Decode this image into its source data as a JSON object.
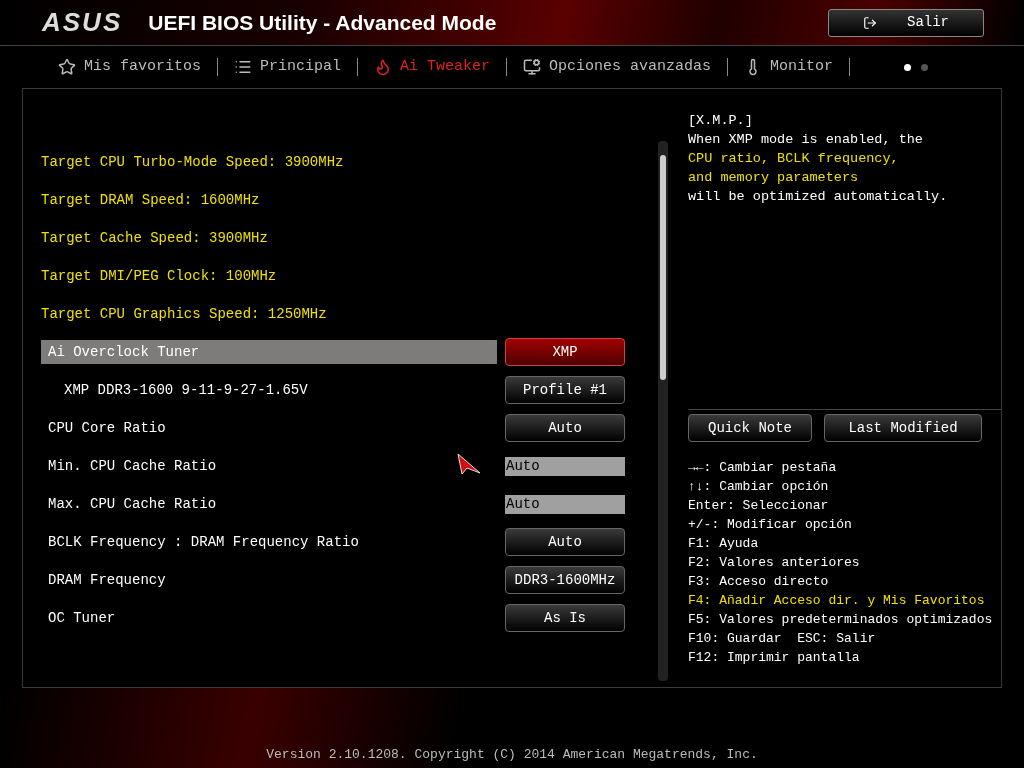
{
  "header": {
    "logo": "ASUS",
    "title": "UEFI BIOS Utility - Advanced Mode",
    "exit_button": "Salir"
  },
  "tabs": [
    {
      "label": "Mis favoritos",
      "selected": false
    },
    {
      "label": "Principal",
      "selected": false
    },
    {
      "label": "Ai Tweaker",
      "selected": true
    },
    {
      "label": "Opciones avanzadas",
      "selected": false
    },
    {
      "label": "Monitor",
      "selected": false
    }
  ],
  "pages": [
    {
      "selected": true
    },
    {
      "selected": false
    }
  ],
  "targets": [
    "Target CPU Turbo-Mode Speed: 3900MHz",
    "Target DRAM Speed: 1600MHz",
    "Target Cache Speed: 3900MHz",
    "Target DMI/PEG Clock: 100MHz",
    "Target CPU Graphics Speed: 1250MHz"
  ],
  "settings": [
    {
      "label": "Ai Overclock Tuner",
      "value": "XMP",
      "kind": "button",
      "selected": true,
      "indented": false
    },
    {
      "label": "XMP DDR3-1600 9-11-9-27-1.65V",
      "value": "Profile #1",
      "kind": "button",
      "selected": false,
      "indented": true
    },
    {
      "label": "CPU Core Ratio",
      "value": "Auto",
      "kind": "button",
      "selected": false,
      "indented": false
    },
    {
      "label": "Min. CPU Cache Ratio",
      "value": "Auto",
      "kind": "field",
      "selected": false,
      "indented": false
    },
    {
      "label": "Max. CPU Cache Ratio",
      "value": "Auto",
      "kind": "field",
      "selected": false,
      "indented": false
    },
    {
      "label": "BCLK Frequency : DRAM Frequency Ratio",
      "value": "Auto",
      "kind": "button",
      "selected": false,
      "indented": false
    },
    {
      "label": "DRAM Frequency",
      "value": "DDR3-1600MHz",
      "kind": "button",
      "selected": false,
      "indented": false
    },
    {
      "label": "OC Tuner",
      "value": "As Is",
      "kind": "button",
      "selected": false,
      "indented": false
    }
  ],
  "help": [
    {
      "text": "[X.M.P.]",
      "highlight": false
    },
    {
      "text": "When XMP mode is enabled, the",
      "highlight": false
    },
    {
      "text": "CPU ratio, BCLK frequency,",
      "highlight": true
    },
    {
      "text": "and memory parameters",
      "highlight": true
    },
    {
      "text": "will be optimized automatically.",
      "highlight": false
    }
  ],
  "side_buttons": [
    "Quick Note",
    "Last Modified"
  ],
  "keys": [
    {
      "text": "→←: Cambiar pestaña",
      "highlight": false
    },
    {
      "text": "↑↓: Cambiar opción",
      "highlight": false
    },
    {
      "text": "Enter: Seleccionar",
      "highlight": false
    },
    {
      "text": "+/-: Modificar opción",
      "highlight": false
    },
    {
      "text": "F1: Ayuda",
      "highlight": false
    },
    {
      "text": "F2: Valores anteriores",
      "highlight": false
    },
    {
      "text": "F3: Acceso directo",
      "highlight": false
    },
    {
      "text": "F4: Añadir Acceso dir. y Mis Favoritos",
      "highlight": true
    },
    {
      "text": "F5: Valores predeterminados optimizados",
      "highlight": false
    },
    {
      "text": "F10: Guardar  ESC: Salir",
      "highlight": false
    },
    {
      "text": "F12: Imprimir pantalla",
      "highlight": false
    }
  ],
  "footer": "Version 2.10.1208. Copyright (C) 2014 American Megatrends, Inc."
}
